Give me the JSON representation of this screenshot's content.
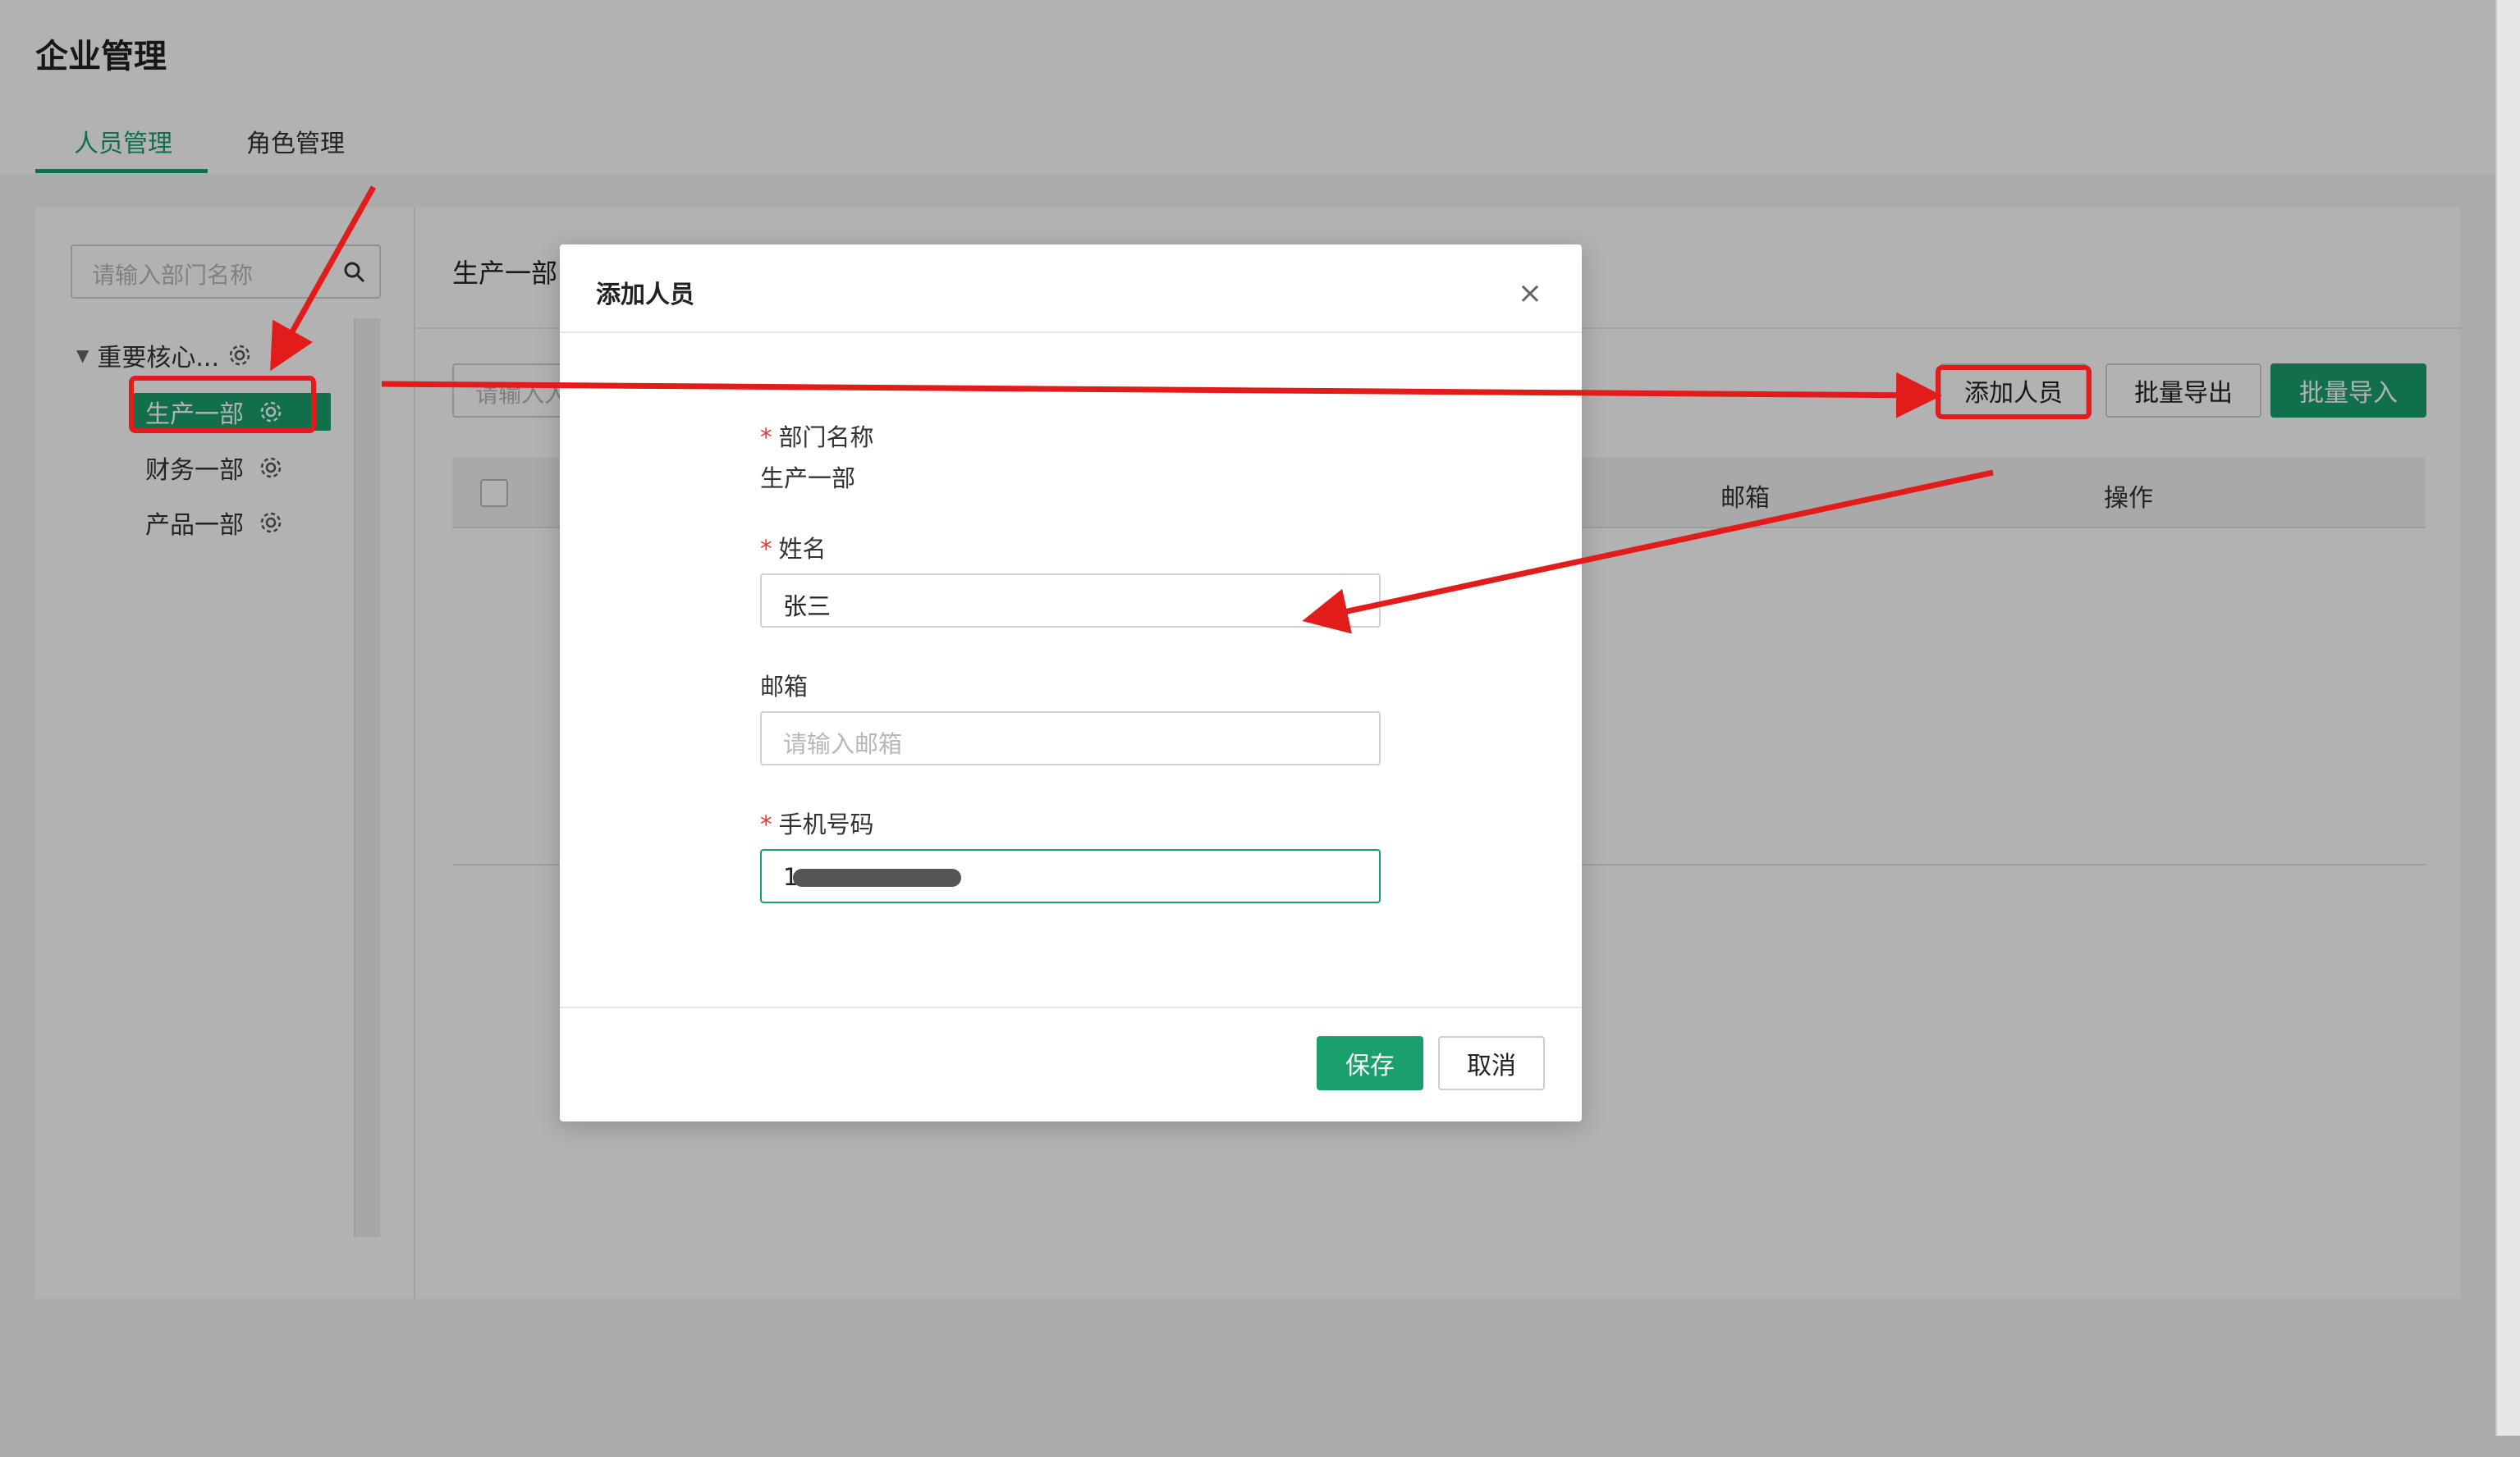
{
  "app": {
    "title": "企业管理"
  },
  "tabs": [
    {
      "label": "人员管理",
      "active": true
    },
    {
      "label": "角色管理",
      "active": false
    }
  ],
  "sidebar": {
    "search_placeholder": "请输入部门名称",
    "tree": {
      "root_label": "重要核心...",
      "children": [
        {
          "label": "生产一部",
          "active": true
        },
        {
          "label": "财务一部",
          "active": false
        },
        {
          "label": "产品一部",
          "active": false
        }
      ]
    }
  },
  "main": {
    "dept_title": "生产一部",
    "search_placeholder_visible": "请输入人",
    "buttons": {
      "add": "添加人员",
      "export": "批量导出",
      "import": "批量导入"
    },
    "table": {
      "columns": [
        "邮箱",
        "操作"
      ]
    }
  },
  "modal": {
    "title": "添加人员",
    "fields": {
      "dept": {
        "label": "部门名称",
        "required": true,
        "value": "生产一部"
      },
      "name": {
        "label": "姓名",
        "required": true,
        "value": "张三"
      },
      "email": {
        "label": "邮箱",
        "required": false,
        "placeholder": "请输入邮箱"
      },
      "phone": {
        "label": "手机号码",
        "required": true,
        "value": "1"
      }
    },
    "buttons": {
      "save": "保存",
      "cancel": "取消"
    }
  },
  "colors": {
    "accent": "#1aa06d",
    "annotation": "#e21b1b",
    "required": "#e03a3a"
  },
  "icons": [
    "search-icon",
    "gear-icon",
    "caret-down-icon",
    "close-icon"
  ]
}
